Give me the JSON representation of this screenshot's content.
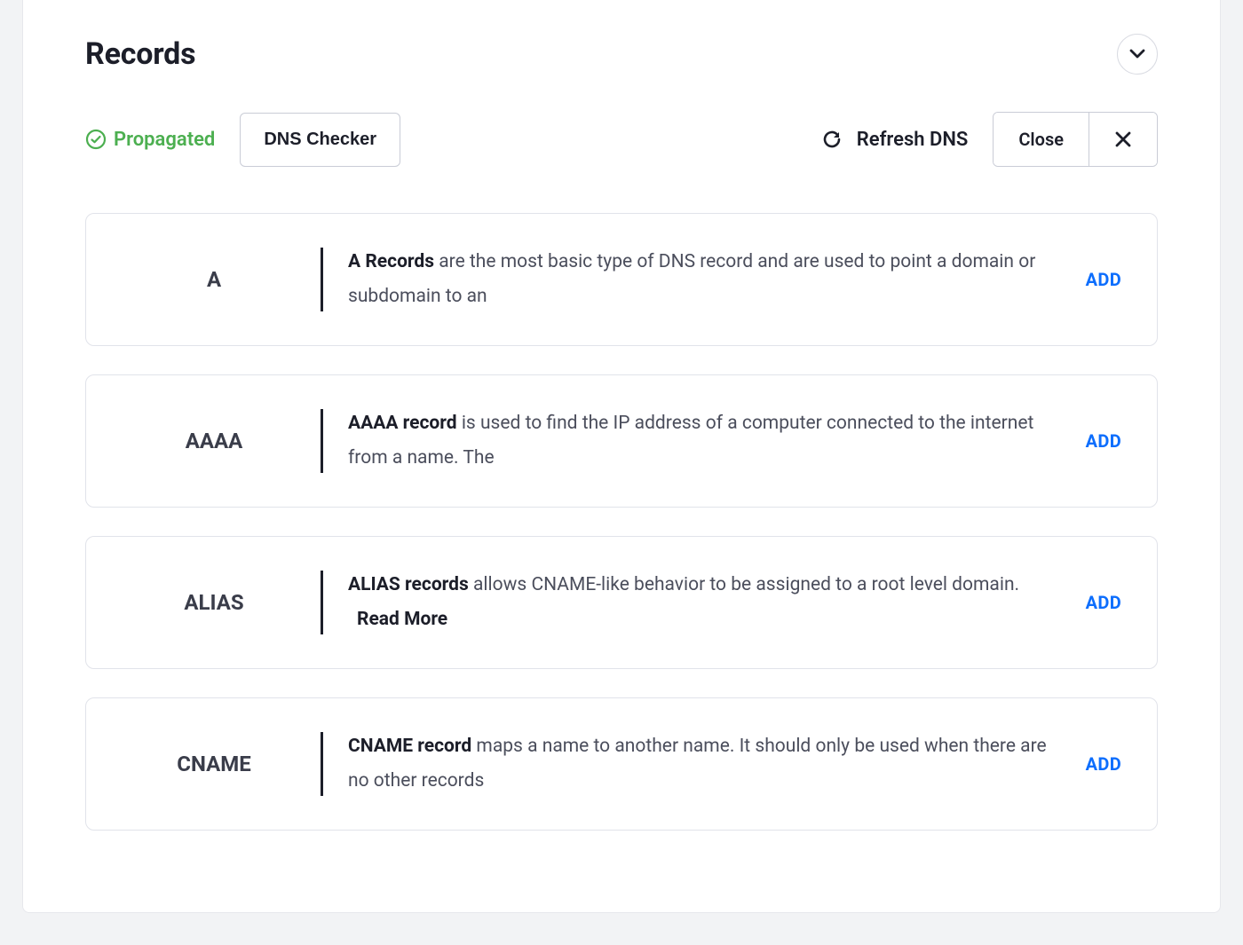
{
  "header": {
    "title": "Records"
  },
  "toolbar": {
    "status_label": "Propagated",
    "dns_checker_label": "DNS Checker",
    "refresh_label": "Refresh DNS",
    "close_label": "Close"
  },
  "records": [
    {
      "type": "A",
      "desc_bold": "A Records",
      "desc_rest": " are the most basic type of DNS record and are used to point a domain or subdomain to an",
      "read_more": "",
      "add_label": "ADD"
    },
    {
      "type": "AAAA",
      "desc_bold": "AAAA record",
      "desc_rest": " is used to find the IP address of a computer connected to the internet from a name. The",
      "read_more": "",
      "add_label": "ADD"
    },
    {
      "type": "ALIAS",
      "desc_bold": "ALIAS records",
      "desc_rest": " allows CNAME-like behavior to be assigned to a root level domain.",
      "read_more": "Read More",
      "add_label": "ADD"
    },
    {
      "type": "CNAME",
      "desc_bold": "CNAME record",
      "desc_rest": " maps a name to another name. It should only be used when there are no other records",
      "read_more": "",
      "add_label": "ADD"
    }
  ]
}
